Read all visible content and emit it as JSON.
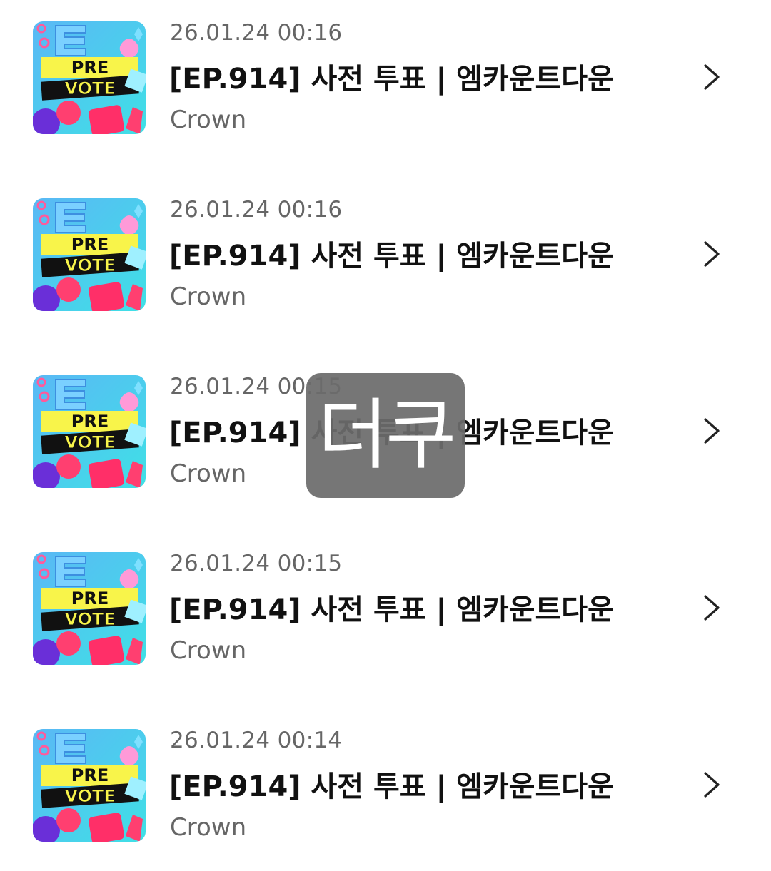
{
  "items": [
    {
      "date": "26.01.24 00:16",
      "title": "[EP.914] 사전 투표 | 엠카운트다운",
      "subtitle": "Crown",
      "thumb": {
        "line1": "PRE",
        "line2": "VOTE",
        "icon": "pre-vote-thumbnail-icon"
      }
    },
    {
      "date": "26.01.24 00:16",
      "title": "[EP.914] 사전 투표 | 엠카운트다운",
      "subtitle": "Crown",
      "thumb": {
        "line1": "PRE",
        "line2": "VOTE",
        "icon": "pre-vote-thumbnail-icon"
      }
    },
    {
      "date": "26.01.24 00:15",
      "title": "[EP.914] 사전 투표 | 엠카운트다운",
      "subtitle": "Crown",
      "thumb": {
        "line1": "PRE",
        "line2": "VOTE",
        "icon": "pre-vote-thumbnail-icon"
      }
    },
    {
      "date": "26.01.24 00:15",
      "title": "[EP.914] 사전 투표 | 엠카운트다운",
      "subtitle": "Crown",
      "thumb": {
        "line1": "PRE",
        "line2": "VOTE",
        "icon": "pre-vote-thumbnail-icon"
      }
    },
    {
      "date": "26.01.24 00:14",
      "title": "[EP.914] 사전 투표 | 엠카운트다운",
      "subtitle": "Crown",
      "thumb": {
        "line1": "PRE",
        "line2": "VOTE",
        "icon": "pre-vote-thumbnail-icon"
      }
    }
  ],
  "watermark": {
    "text": "더쿠"
  },
  "icons": {
    "chevron": "chevron-right-icon"
  },
  "colors": {
    "title": "#111111",
    "meta": "#666666",
    "thumb_bg": "#4ec9f0",
    "thumb_banner": "#f8f44a",
    "thumb_band": "#111111",
    "watermark_bg": "#6c6c6c"
  }
}
